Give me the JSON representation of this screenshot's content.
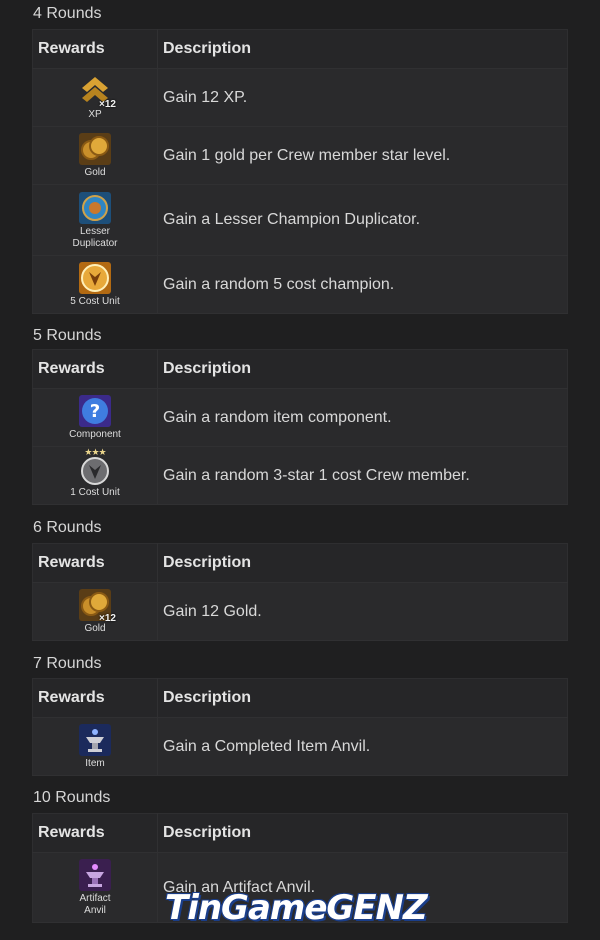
{
  "table_headers": {
    "rewards": "Rewards",
    "description": "Description"
  },
  "sections": [
    {
      "title": "4 Rounds",
      "rows": [
        {
          "label": "XP",
          "icon": "xp-chevron-icon",
          "mult": "×12",
          "description": "Gain 12 XP."
        },
        {
          "label": "Gold",
          "icon": "gold-coins-icon",
          "mult": "",
          "description": "Gain 1 gold per Crew member star level."
        },
        {
          "label": "Lesser Duplicator",
          "icon": "lesser-duplicator-icon",
          "mult": "",
          "description": "Gain a Lesser Champion Duplicator."
        },
        {
          "label": "5 Cost Unit",
          "icon": "five-cost-unit-icon",
          "mult": "",
          "description": "Gain a random 5 cost champion."
        }
      ]
    },
    {
      "title": "5 Rounds",
      "rows": [
        {
          "label": "Component",
          "icon": "component-question-icon",
          "mult": "",
          "description": "Gain a random item component."
        },
        {
          "label": "1 Cost Unit",
          "icon": "one-cost-unit-icon",
          "mult": "",
          "stars": "★★★",
          "description": "Gain a random 3-star 1 cost Crew member."
        }
      ]
    },
    {
      "title": "6 Rounds",
      "rows": [
        {
          "label": "Gold",
          "icon": "gold-coins-icon",
          "mult": "×12",
          "description": "Gain 12 Gold."
        }
      ]
    },
    {
      "title": "7 Rounds",
      "rows": [
        {
          "label": "Item",
          "icon": "item-anvil-icon",
          "mult": "",
          "description": "Gain a Completed Item Anvil."
        }
      ]
    },
    {
      "title": "10 Rounds",
      "rows": [
        {
          "label": "Artifact Anvil",
          "icon": "artifact-anvil-icon",
          "mult": "",
          "description": "Gain an Artifact Anvil."
        }
      ]
    }
  ],
  "watermark": "TinGameGENZ"
}
